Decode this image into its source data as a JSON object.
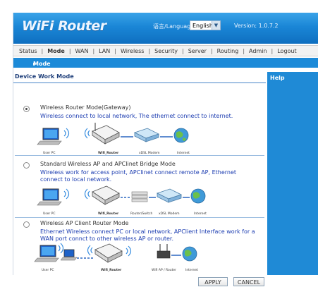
{
  "header": {
    "logo": "WiFi Router",
    "language_label": "语言/Language:",
    "language_selected": "English",
    "version": "Version: 1.0.7.2"
  },
  "nav": {
    "items": [
      "Status",
      "Mode",
      "WAN",
      "LAN",
      "Wireless",
      "Security",
      "Server",
      "Routing",
      "Admin",
      "Logout"
    ],
    "active": "Mode"
  },
  "breadcrumb": "Mode",
  "section_title": "Device Work Mode",
  "help_title": "Help",
  "modes": [
    {
      "name": "Wireless Router Mode(Gateway)",
      "description": "Wireless connect to local network, The ethernet connect to internet.",
      "selected": true,
      "diagram_labels": [
        "User PC",
        "Wifi_Router",
        "xDSL Modem",
        "Internet"
      ]
    },
    {
      "name": "Standard Wireless AP and APClinet Bridge Mode",
      "description": "Wireless work for access point, APClinet connect remote AP, Ethernet connect to local network.",
      "selected": false,
      "diagram_labels": [
        "User PC",
        "Wifi_Router",
        "Router/Switch",
        "xDSL Modem",
        "Internet"
      ]
    },
    {
      "name": "Wireless AP Client Router Mode",
      "description": "Ethernet Wireless connect PC or local network, APClient Interface work for a WAN port connct to other wireless AP or router.",
      "selected": false,
      "diagram_labels": [
        "User PC",
        "Wifi_Router",
        "Wifi AP / Router",
        "Internet"
      ]
    }
  ],
  "buttons": {
    "apply": "APPLY",
    "cancel": "CANCEL"
  }
}
